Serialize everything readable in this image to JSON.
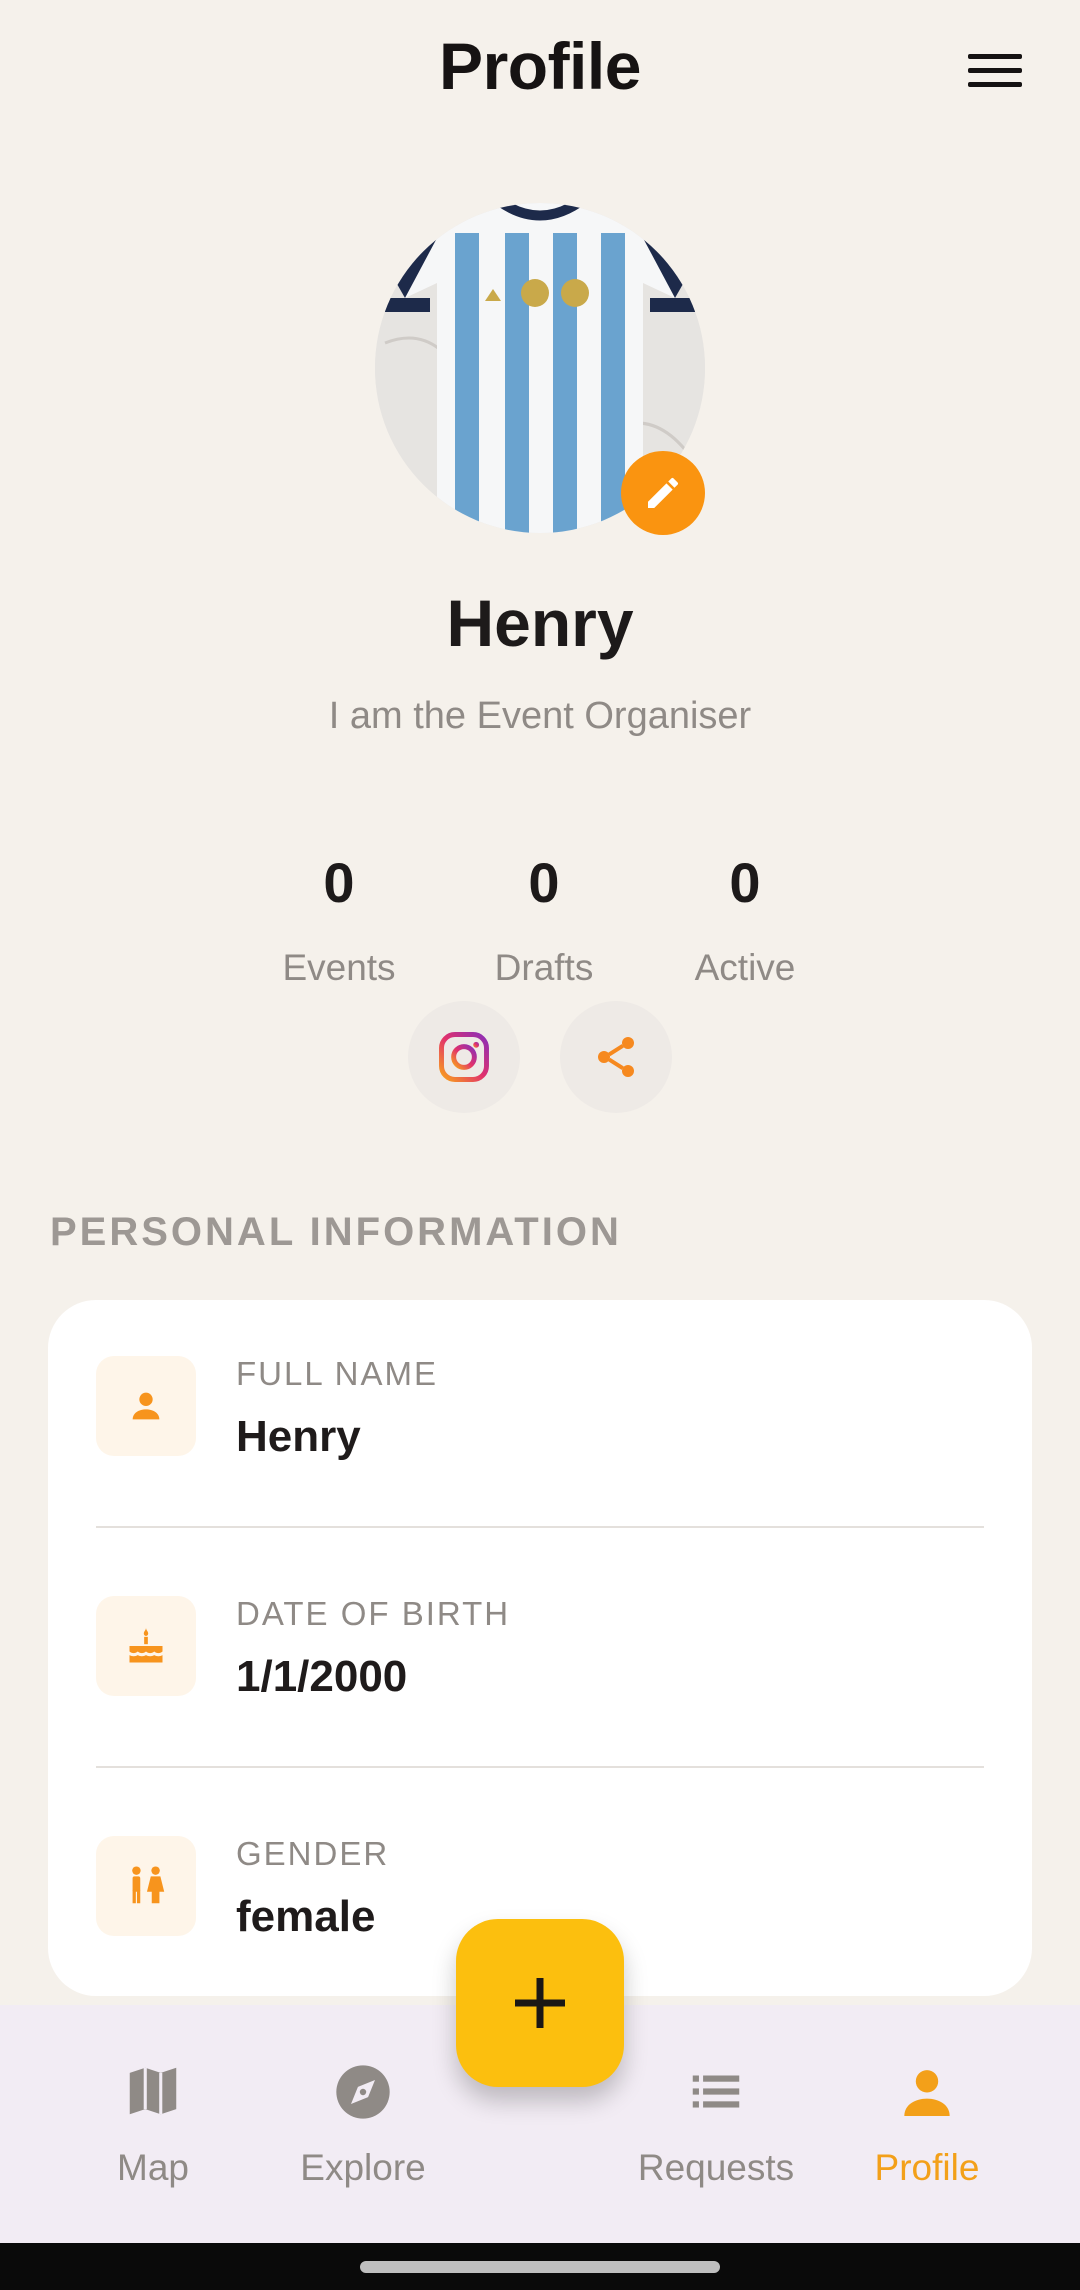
{
  "header": {
    "title": "Profile",
    "menu_icon": "hamburger-menu-icon"
  },
  "profile": {
    "avatar_alt": "striped football jersey photo",
    "name": "Henry",
    "bio": "I am the Event Organiser"
  },
  "stats": [
    {
      "value": "0",
      "label": "Events"
    },
    {
      "value": "0",
      "label": "Drafts"
    },
    {
      "value": "0",
      "label": "Active"
    }
  ],
  "social": {
    "instagram_icon": "instagram-icon",
    "share_icon": "share-icon"
  },
  "personal_info": {
    "title": "PERSONAL INFORMATION",
    "rows": [
      {
        "label": "FULL NAME",
        "value": "Henry",
        "icon": "person-icon"
      },
      {
        "label": "DATE OF BIRTH",
        "value": "1/1/2000",
        "icon": "cake-icon"
      },
      {
        "label": "GENDER",
        "value": "female",
        "icon": "gender-icon"
      }
    ]
  },
  "nav": {
    "items": [
      {
        "label": "Map",
        "icon": "map-icon"
      },
      {
        "label": "Explore",
        "icon": "explore-compass-icon"
      },
      {
        "label": "Requests",
        "icon": "list-icon"
      },
      {
        "label": "Profile",
        "icon": "person-icon",
        "active": true
      }
    ],
    "fab_icon": "plus-icon"
  },
  "colors": {
    "accent": "#fa9410",
    "fab": "#fcbf0e",
    "background": "#f5f1eb",
    "nav_active": "#f3a019"
  }
}
